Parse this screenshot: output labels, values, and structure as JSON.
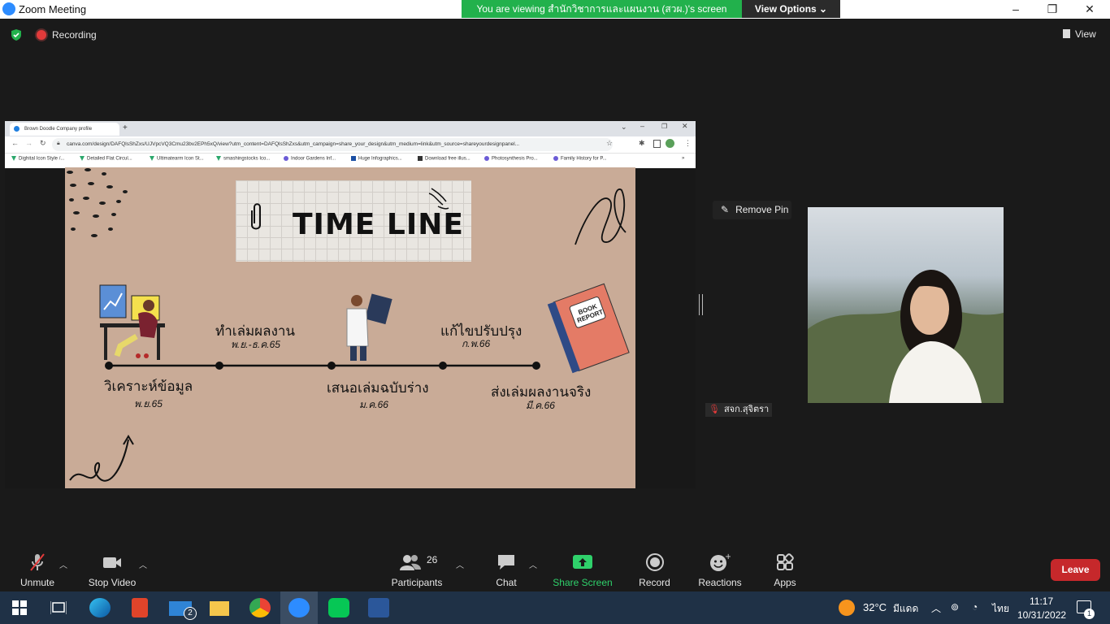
{
  "window": {
    "title": "Zoom Meeting",
    "controls": [
      "–",
      "❐",
      "✕"
    ]
  },
  "share_banner": {
    "text": "You are viewing สำนักวิชาการและแผนงาน (สวผ.)'s screen",
    "view_options": "View Options ⌄"
  },
  "header": {
    "recording_label": "Recording",
    "view_label": "View"
  },
  "browser": {
    "tab_title": "Brown Doodle Company profile",
    "new_tab": "+",
    "url": "canva.com/design/DAFQlsShZxs/UJVpcVQ3Cmu23bv2EPh5xQ/view?utm_content=DAFQlsShZxs&utm_campaign=share_your_design&utm_medium=link&utm_source=shareyourdesignpanel...",
    "bookmarks": [
      {
        "label": "Dighital Icon Style /...",
        "color": "#2aa76b"
      },
      {
        "label": "Detailed Flat Circul...",
        "color": "#2aa76b"
      },
      {
        "label": "Ultimatearm Icon St...",
        "color": "#2aa76b"
      },
      {
        "label": "smashingstocks Ico...",
        "color": "#2aa76b"
      },
      {
        "label": "Indoor Gardens Inf...",
        "color": "#6b5bd6"
      },
      {
        "label": "Huge Infographics...",
        "color": "#1a4fa3"
      },
      {
        "label": "Download free illus...",
        "color": "#333333"
      },
      {
        "label": "Photosynthesis Pro...",
        "color": "#6b5bd6"
      },
      {
        "label": "Family History for P...",
        "color": "#6b5bd6"
      }
    ]
  },
  "slide": {
    "title": "TIME LINE",
    "milestones": [
      {
        "label": "วิเคราะห์ข้อมูล",
        "date": "พ.ย.65"
      },
      {
        "label": "ทำเล่มผลงาน",
        "date": "พ.ย.-ธ.ค.65"
      },
      {
        "label": "เสนอเล่มฉบับร่าง",
        "date": "ม.ค.66"
      },
      {
        "label": "แก้ไขปรับปรุง",
        "date": "ก.พ.66"
      },
      {
        "label": "ส่งเล่มผลงานจริง",
        "date": "มี.ค.66"
      }
    ],
    "book_text_1": "BOOK",
    "book_text_2": "REPORT"
  },
  "participant": {
    "remove_pin": "Remove Pin",
    "name": "สจก.สุจิตรา"
  },
  "toolbar": {
    "unmute": "Unmute",
    "stop_video": "Stop Video",
    "participants": "Participants",
    "participants_count": "26",
    "chat": "Chat",
    "share_screen": "Share Screen",
    "record": "Record",
    "reactions": "Reactions",
    "apps": "Apps",
    "leave": "Leave"
  },
  "taskbar": {
    "mail_badge": "2",
    "weather": "32°C",
    "weather_text": "มีแดด",
    "lang": "ไทย",
    "time": "11:17",
    "date": "10/31/2022",
    "notif_count": "1"
  },
  "colors": {
    "share_banner": "#22b14c",
    "share_screen": "#2fd16b",
    "leave": "#c6282b",
    "slide_bg": "#c9ab97"
  }
}
